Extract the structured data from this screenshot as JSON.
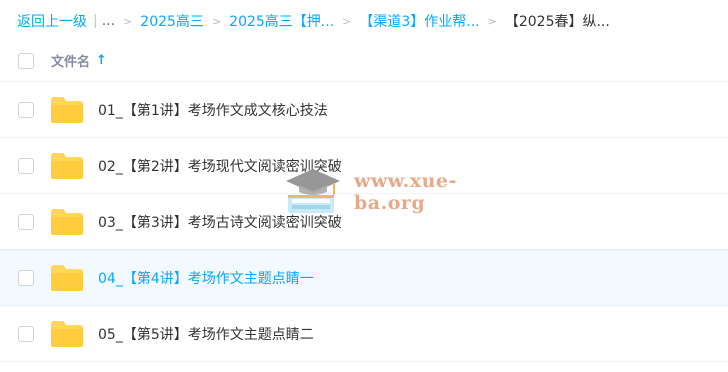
{
  "breadcrumb": {
    "back": "返回上一级",
    "pipe": "|",
    "ellipsis": "...",
    "items": [
      "2025高三",
      "2025高三【押...",
      "【渠道3】作业帮...",
      "【2025春】纵..."
    ]
  },
  "list_header": {
    "column_name": "文件名",
    "sort_icon": "arrow-up-icon"
  },
  "rows": [
    {
      "name": "01_【第1讲】考场作文成文核心技法"
    },
    {
      "name": "02_【第2讲】考场现代文阅读密训突破"
    },
    {
      "name": "03_【第3讲】考场古诗文阅读密训突破"
    },
    {
      "name": "04_【第4讲】考场作文主题点睛一"
    },
    {
      "name": "05_【第5讲】考场作文主题点睛二"
    }
  ],
  "watermark": {
    "text": "www.xue-ba.org"
  },
  "colors": {
    "accent": "#06a7ff",
    "folder": "#ffd65c",
    "hover_row": "#f2f9ff",
    "watermark": "#e8a98a"
  }
}
